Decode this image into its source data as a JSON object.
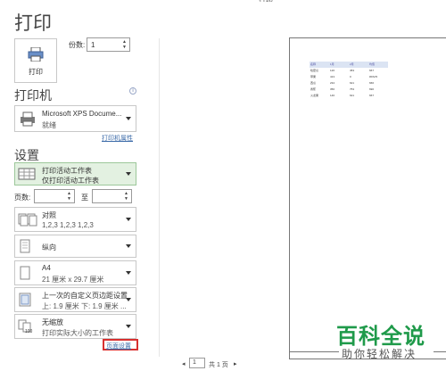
{
  "window_title": "打印",
  "title": "打印",
  "print_button": {
    "label": "打印",
    "icon": "printer-icon"
  },
  "copies": {
    "label": "份数:",
    "value": "1"
  },
  "printer_section": {
    "heading": "打印机",
    "info_icon": "i",
    "selected": {
      "name": "Microsoft XPS Docume...",
      "status": "就绪"
    },
    "properties_link": "打印机属性"
  },
  "settings_section": {
    "heading": "设置",
    "scope": {
      "line1": "打印活动工作表",
      "line2": "仅打印活动工作表"
    },
    "pages": {
      "label": "页数:",
      "to": "至",
      "from_value": "",
      "to_value": ""
    },
    "collate": {
      "line1": "对照",
      "line2": "1,2,3    1,2,3    1,2,3"
    },
    "orientation": {
      "line1": "纵向"
    },
    "paper": {
      "line1": "A4",
      "line2": "21 厘米 x 29.7 厘米"
    },
    "margins": {
      "line1": "上一次的自定义页边距设置",
      "line2": "上: 1.9 厘米 下: 1.9 厘米 ..."
    },
    "scaling": {
      "line1": "无缩放",
      "line2": "打印实际大小的工作表"
    },
    "page_setup_link": "页面设置"
  },
  "preview": {
    "table": {
      "headers": [
        "名称",
        "1月",
        "2月",
        "均值"
      ],
      "rows": [
        [
          "哈密瓜",
          "126",
          "453",
          "667"
        ],
        [
          "苹果",
          "413",
          "0",
          "#DIV/0"
        ],
        [
          "西瓜",
          "234",
          "621",
          "666"
        ],
        [
          "香蕉",
          "356",
          "753",
          "690"
        ],
        [
          "火龙果",
          "146",
          "621",
          "667"
        ]
      ]
    },
    "pager": {
      "current": "1",
      "total": "共 1 页"
    }
  },
  "watermark": {
    "main": "百科全说",
    "sub": "助你轻松解决"
  },
  "colors": {
    "accent_green": "#e3f1e1",
    "link_blue": "#3b6aa8",
    "highlight_red": "#d83030",
    "brand_green": "#1f9a4a"
  }
}
